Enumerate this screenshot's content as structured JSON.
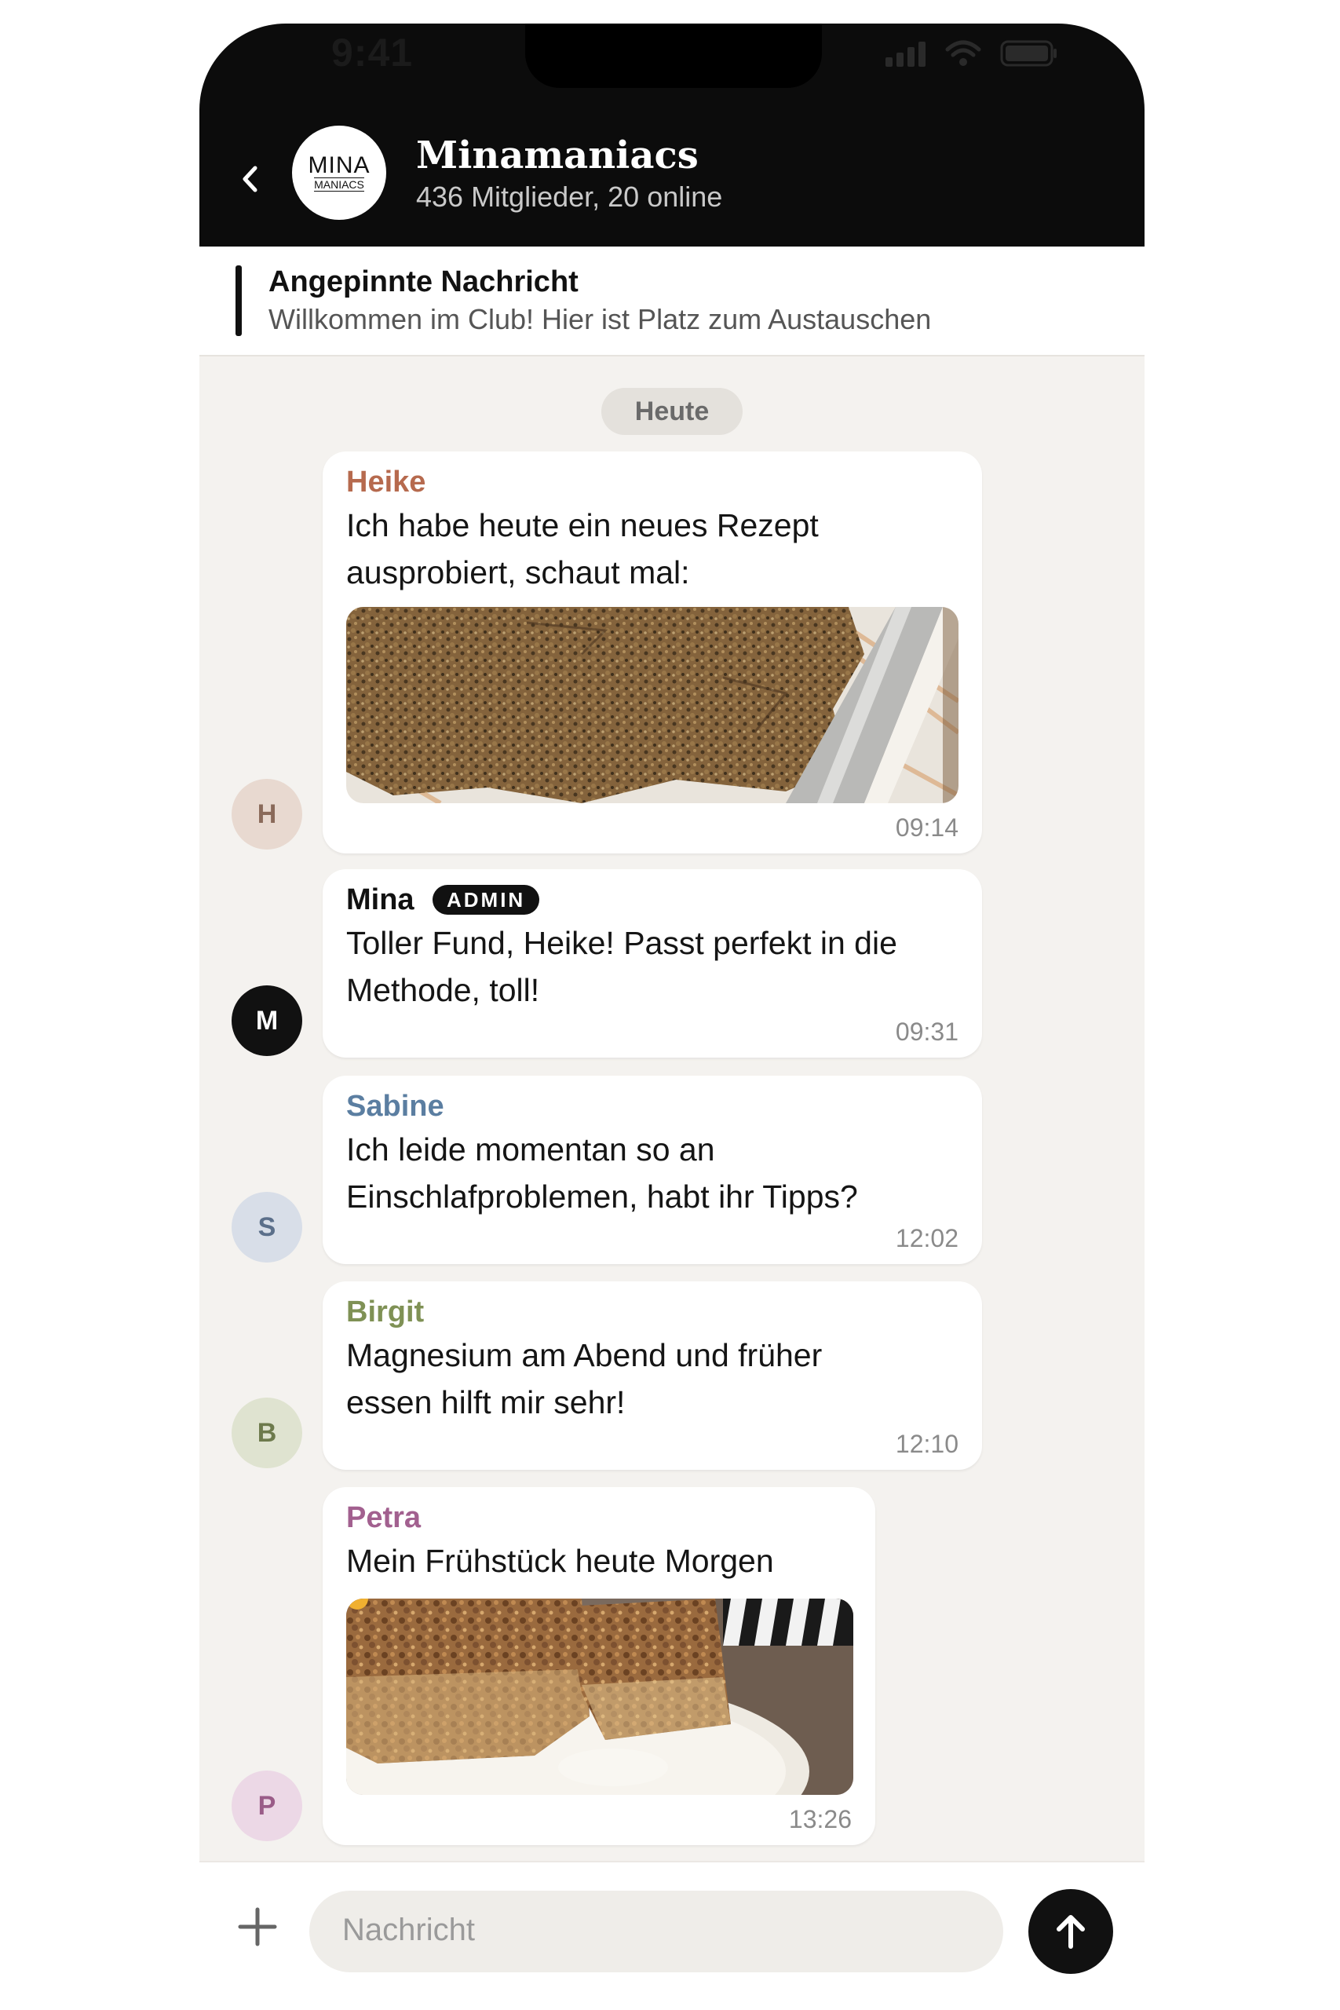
{
  "status": {
    "time": "9:41"
  },
  "header": {
    "back_icon": "chevron-left-icon",
    "avatar_line1": "MINA",
    "avatar_line2": "MANIACS",
    "title": "Minamaniacs",
    "subtitle": "436 Mitglieder, 20 online"
  },
  "pinned": {
    "title": "Angepinnte Nachricht",
    "text": "Willkommen im Club! Hier ist Platz zum Austauschen"
  },
  "date_chip": "Heute",
  "messages": [
    {
      "initial": "H",
      "sender": "Heike",
      "line1": "Ich habe heute ein neues Rezept",
      "line2": "ausprobiert, schaut mal:",
      "time": "09:14",
      "color": "#b66a4e",
      "avatar_bg": "#e8d9d0",
      "avatar_fg": "#8a6a5a"
    },
    {
      "initial": "M",
      "sender": "Mina",
      "badge": "ADMIN",
      "line1": "Toller Fund, Heike! Passt perfekt in die",
      "line2": "Methode, toll!",
      "time": "09:31",
      "color": "#111111",
      "avatar_bg": "#111111",
      "avatar_fg": "#ffffff"
    },
    {
      "initial": "S",
      "sender": "Sabine",
      "line1": "Ich leide momentan so an",
      "line2": "Einschlafproblemen, habt ihr Tipps?",
      "time": "12:02",
      "color": "#5b7ea1",
      "avatar_bg": "#d8dee8",
      "avatar_fg": "#5b6f8a"
    },
    {
      "initial": "B",
      "sender": "Birgit",
      "line1": "Magnesium am Abend und früher",
      "line2": "essen hilft mir sehr!",
      "time": "12:10",
      "color": "#7f9155",
      "avatar_bg": "#dfe3d0",
      "avatar_fg": "#6d7a4c"
    },
    {
      "initial": "P",
      "sender": "Petra",
      "line1": "Mein Frühstück heute Morgen",
      "time": "13:26",
      "color": "#a2608f",
      "avatar_bg": "#ecd8e6",
      "avatar_fg": "#9a5c88"
    }
  ],
  "composer": {
    "placeholder": "Nachricht",
    "plus_icon": "plus-icon",
    "send_icon": "arrow-up-icon"
  }
}
